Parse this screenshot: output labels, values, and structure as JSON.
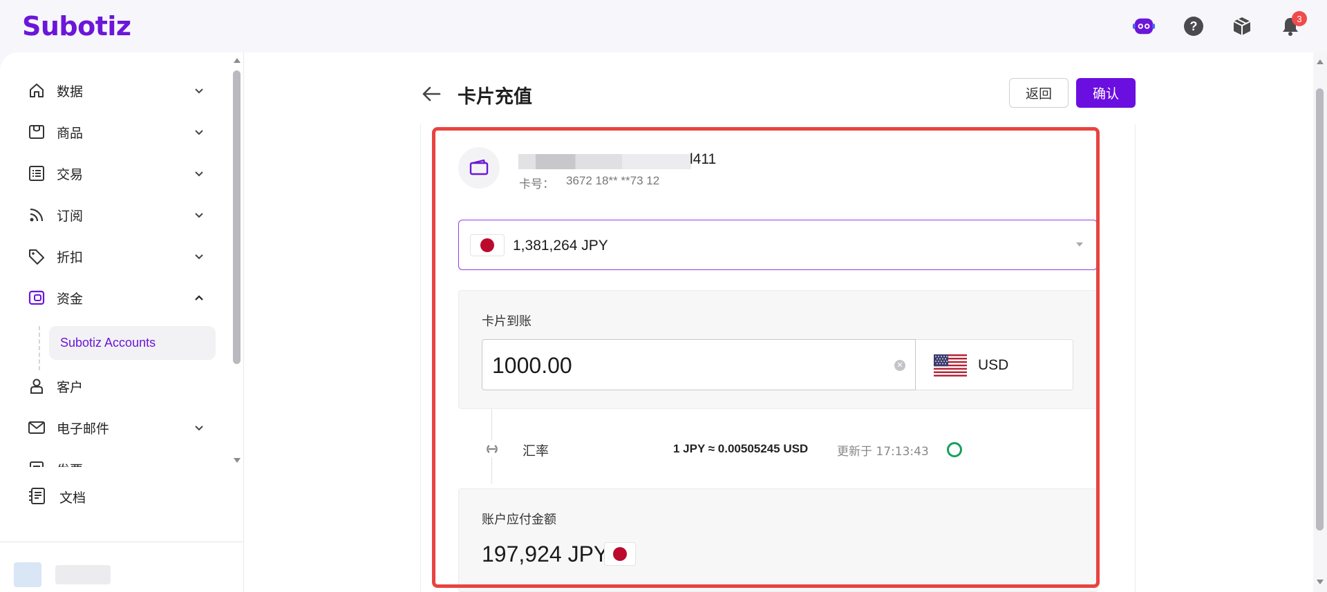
{
  "app": {
    "logo": "Subotiz"
  },
  "topbar": {
    "notification_count": "3",
    "brand_color": "#6b16d9"
  },
  "sidebar": {
    "items": [
      {
        "label": "数据",
        "icon": "home-icon"
      },
      {
        "label": "商品",
        "icon": "store-icon"
      },
      {
        "label": "交易",
        "icon": "list-icon"
      },
      {
        "label": "订阅",
        "icon": "rss-icon"
      },
      {
        "label": "折扣",
        "icon": "tag-icon"
      },
      {
        "label": "资金",
        "icon": "wallet-icon"
      },
      {
        "label": "客户",
        "icon": "user-icon"
      },
      {
        "label": "电子邮件",
        "icon": "mail-icon"
      },
      {
        "label": "发票",
        "icon": "invoice-icon"
      }
    ],
    "sub_item": "Subotiz Accounts",
    "docs_label": "文档"
  },
  "page": {
    "title": "卡片充值",
    "back_button": "返回",
    "confirm_button": "确认"
  },
  "card": {
    "name_suffix": "l411",
    "number_label": "卡号：",
    "number": "3672 18** **73 12"
  },
  "account": {
    "balance": "1,381,264 JPY"
  },
  "receive": {
    "label": "卡片到账",
    "amount": "1000.00",
    "currency": "USD"
  },
  "rate": {
    "label": "汇率",
    "value": "1 JPY ≈ 0.00505245 USD",
    "updated": "更新于 17:13:43"
  },
  "payable": {
    "label": "账户应付金额",
    "amount": "197,924 JPY"
  }
}
